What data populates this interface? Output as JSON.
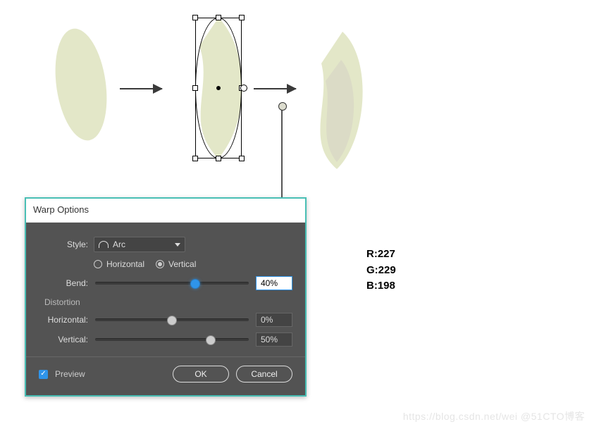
{
  "illustration": {
    "rgb_label_r": "R:227",
    "rgb_label_g": "G:229",
    "rgb_label_b": "B:198",
    "shape_color": "#e3e5c6",
    "inner_color": "#dbdbc6"
  },
  "dialog": {
    "title": "Warp Options",
    "style_label": "Style:",
    "style_value": "Arc",
    "orientation": {
      "horizontal": "Horizontal",
      "vertical": "Vertical",
      "selected": "vertical"
    },
    "bend": {
      "label": "Bend:",
      "value": "40%",
      "pos": 62
    },
    "distortion": {
      "section": "Distortion",
      "horizontal": {
        "label": "Horizontal:",
        "value": "0%",
        "pos": 50
      },
      "vertical": {
        "label": "Vertical:",
        "value": "50%",
        "pos": 72
      }
    },
    "preview": {
      "label": "Preview",
      "checked": true
    },
    "ok": "OK",
    "cancel": "Cancel"
  },
  "watermark": "https://blog.csdn.net/wei   @51CTO博客"
}
